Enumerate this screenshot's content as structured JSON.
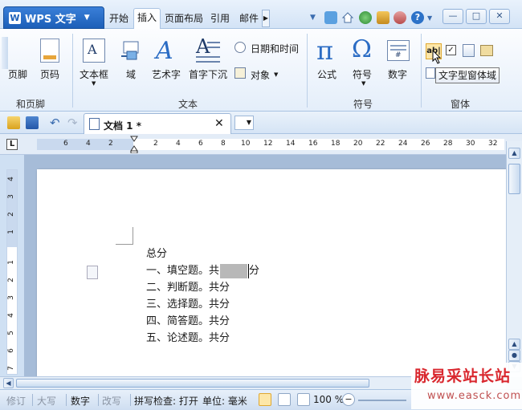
{
  "app": {
    "name": "WPS 文字",
    "logo": "W"
  },
  "menu_tabs": [
    "开始",
    "插入",
    "页面布局",
    "引用",
    "邮件"
  ],
  "active_tab": "插入",
  "ribbon": {
    "items": {
      "footer": "页脚",
      "page_number": "页码",
      "textbox": "文本框",
      "field": "域",
      "wordart": "艺术字",
      "dropcap": "首字下沉",
      "datetime": "日期和时间",
      "object": "对象",
      "formula": "公式",
      "symbol": "符号",
      "number": "数字"
    },
    "groups": {
      "header_footer": "和页脚",
      "text": "文本",
      "symbols": "符号",
      "forms": "窗体"
    }
  },
  "tooltip": "文字型窗体域",
  "document": {
    "tab_title": "文档 1 *",
    "lines": [
      "总分",
      "一、填空题。共",
      "二、判断题。共分",
      "三、选择题。共分",
      "四、简答题。共分",
      "五、论述题。共分"
    ],
    "line2_suffix": "分"
  },
  "ruler": {
    "h_numbers": [
      "6",
      "4",
      "2",
      "2",
      "4",
      "6",
      "8",
      "10",
      "12",
      "14",
      "16",
      "18",
      "20",
      "22",
      "24",
      "26",
      "28",
      "30",
      "32"
    ],
    "v_numbers": [
      "4",
      "3",
      "2",
      "1",
      "1",
      "2",
      "3",
      "4",
      "5",
      "6",
      "7"
    ],
    "corner": "L"
  },
  "statusbar": {
    "revise": "修订",
    "caps": "大写",
    "num": "数字",
    "overwrite": "改写",
    "spellcheck": "拼写检查: 打开",
    "unit": "单位: 毫米",
    "zoom": "100 %"
  },
  "watermark": {
    "top": "脉易采站长站",
    "bottom": "www.easck.com"
  },
  "colors": {
    "accent": "#1c5fb8",
    "ribbon_bg": "#e4eefa",
    "workspace": "#a6bcd8",
    "watermark": "#d9272e"
  }
}
